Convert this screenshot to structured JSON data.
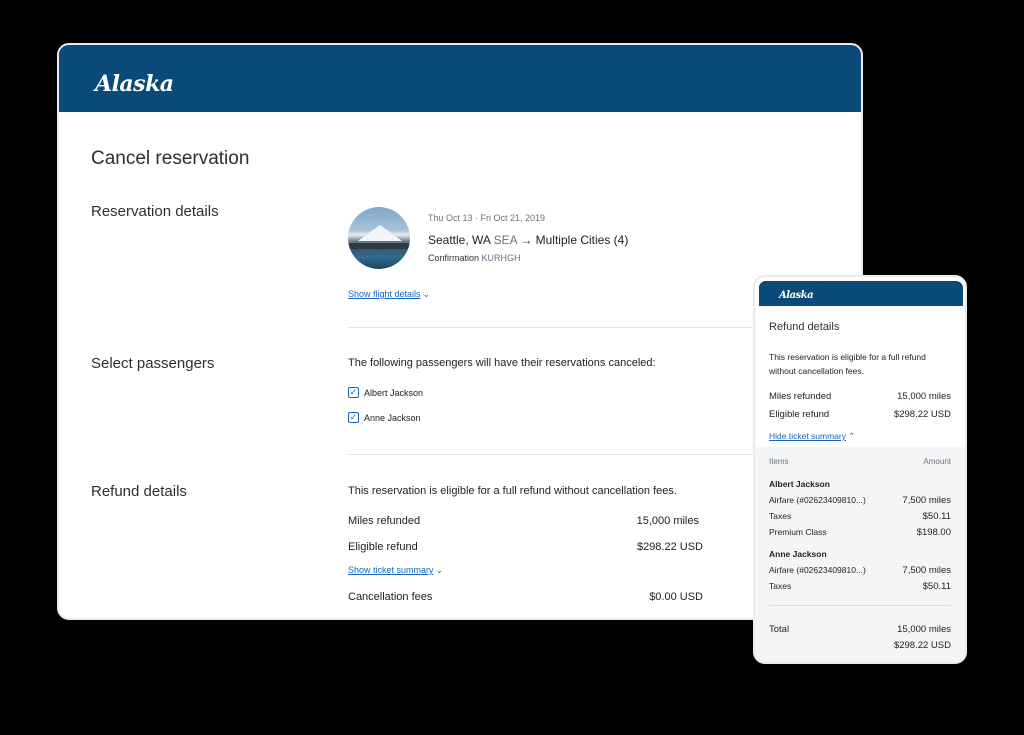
{
  "desktop": {
    "brand": "Alaska",
    "page_title": "Cancel reservation",
    "reservation": {
      "section_title": "Reservation details",
      "dates": "Thu Oct 13 · Fri Oct 21, 2019",
      "origin": "Seattle, WA",
      "origin_code": "SEA",
      "arrow": "→",
      "destination": "Multiple Cities (4)",
      "confirmation_label": "Confirmation",
      "confirmation_code": "KURHGH",
      "show_flight_details": "Show flight details"
    },
    "passengers": {
      "section_title": "Select passengers",
      "intro": "The following passengers will have their reservations canceled:",
      "list": [
        {
          "name": "Albert Jackson",
          "checked": true
        },
        {
          "name": "Anne Jackson",
          "checked": true
        }
      ]
    },
    "refund": {
      "section_title": "Refund details",
      "note": "This reservation is eligible for a full refund without cancellation fees.",
      "miles_label": "Miles refunded",
      "miles_value": "15,000 miles",
      "eligible_label": "Eligible refund",
      "eligible_value": "$298.22 USD",
      "show_ticket_summary": "Show ticket summary",
      "fees_label": "Cancellation fees",
      "fees_value": "$0.00 USD"
    }
  },
  "mobile": {
    "brand": "Alaska",
    "title": "Refund details",
    "note": "This reservation is eligible for a full refund without cancellation fees.",
    "miles_label": "Miles refunded",
    "miles_value": "15,000 miles",
    "eligible_label": "Eligible refund",
    "eligible_value": "$298.22 USD",
    "hide_ticket_summary": "Hide ticket summary",
    "summary": {
      "col_items": "Items",
      "col_amount": "Amount",
      "passengers": [
        {
          "name": "Albert Jackson",
          "items": [
            {
              "label": "Airfare (#02623409810...)",
              "amount": "7,500 miles"
            },
            {
              "label": "Taxes",
              "amount": "$50.11"
            },
            {
              "label": "Premium Class",
              "amount": "$198.00"
            }
          ]
        },
        {
          "name": "Anne Jackson",
          "items": [
            {
              "label": "Airfare (#02623409810...)",
              "amount": "7,500 miles"
            },
            {
              "label": "Taxes",
              "amount": "$50.11"
            }
          ]
        }
      ],
      "total_label": "Total",
      "total_miles": "15,000 miles",
      "total_amount": "$298.22 USD"
    }
  },
  "colors": {
    "header_blue": "#0a4a78",
    "accent_blue": "#3b8fc4",
    "link_blue": "#1565c0"
  },
  "icons": {
    "chevron_down": "chevron-down-icon",
    "chevron_up": "chevron-up-icon",
    "check": "checkmark-icon",
    "arrow": "arrow-right-icon"
  }
}
